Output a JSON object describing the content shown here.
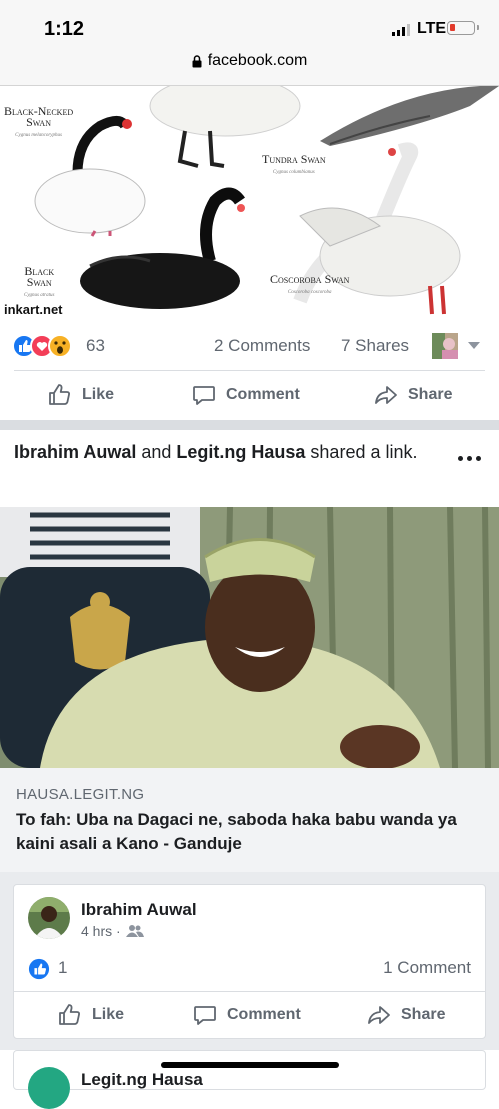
{
  "status_bar": {
    "time": "1:12",
    "network": "LTE"
  },
  "browser": {
    "url": "facebook.com"
  },
  "post1": {
    "image": {
      "labels": [
        {
          "name": "Black-Necked Swan",
          "line1": "Black-Necked",
          "line2": "Swan",
          "sci": "Cygnus melancoryphus"
        },
        {
          "name": "Tundra Swan",
          "line1": "Tundra Swan",
          "line2": "",
          "sci": "Cygnus columbianus"
        },
        {
          "name": "Black Swan",
          "line1": "Black",
          "line2": "Swan",
          "sci": "Cygnus atratus"
        },
        {
          "name": "Coscoroba Swan",
          "line1": "Coscoroba Swan",
          "line2": "",
          "sci": "Coscoroba coscoroba"
        }
      ],
      "watermark": "inkart.net"
    },
    "reaction_count": "63",
    "comments": "2 Comments",
    "shares": "7 Shares",
    "actions": {
      "like": "Like",
      "comment": "Comment",
      "share": "Share"
    }
  },
  "post2": {
    "header": {
      "actor1": "Ibrahim Auwal",
      "conj": " and ",
      "actor2": "Legit.ng Hausa",
      "verb": " shared a link."
    },
    "link": {
      "domain": "HAUSA.LEGIT.NG",
      "title": "To fah: Uba na Dagaci ne, saboda haka babu wanda ya kaini asali a Kano - Ganduje"
    }
  },
  "comment_card": {
    "name": "Ibrahim Auwal",
    "time": "4 hrs ·",
    "like_count": "1",
    "comments": "1 Comment",
    "actions": {
      "like": "Like",
      "comment": "Comment",
      "share": "Share"
    }
  },
  "next_card": {
    "name": "Legit.ng Hausa"
  },
  "colors": {
    "fb_blue": "#1877f2",
    "love_red": "#f33e58",
    "wow_yellow": "#f7b125",
    "text_gray": "#606770"
  }
}
